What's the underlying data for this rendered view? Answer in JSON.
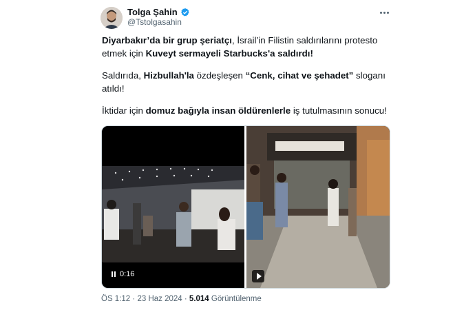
{
  "author": {
    "display_name": "Tolga Şahin",
    "handle": "@Tstolgasahin",
    "verified": true
  },
  "tweet": {
    "p1": {
      "b1": "Diyarbakır’da bir grup şeriatçı",
      "t1": ", İsrail’in Filistin saldırılarını protesto etmek için ",
      "b2": "Kuveyt sermayeli Starbucks'a saldırdı!"
    },
    "p2": {
      "t1": "Saldırıda, ",
      "b1": "Hizbullah'la",
      "t2": " özdeşleşen ",
      "b2": "“Cenk, cihat ve şehadet”",
      "t3": " sloganı atıldı!"
    },
    "p3": {
      "t1": "İktidar için ",
      "b1": "domuz bağıyla insan öldürenlerle",
      "t2": " iş tutulmasının sonucu!"
    }
  },
  "media": {
    "video1_duration": "0:16"
  },
  "meta": {
    "time": "ÖS 1:12",
    "sep1": "·",
    "date": "23 Haz 2024",
    "sep2": "·",
    "views_count": "5.014",
    "views_label": "Görüntülenme"
  },
  "colors": {
    "verified_blue": "#1d9bf0",
    "secondary_text": "#536471",
    "primary_text": "#0f1419"
  },
  "icons": {
    "verified": "verified-badge-icon",
    "more": "more-options-icon",
    "pause": "pause-icon",
    "play": "play-icon"
  }
}
